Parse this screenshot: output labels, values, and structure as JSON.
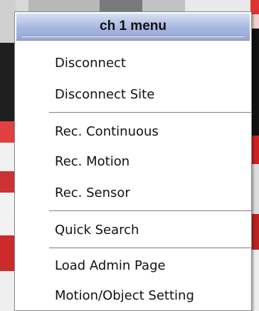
{
  "menu": {
    "title": "ch 1 menu",
    "items": [
      {
        "label": "Disconnect"
      },
      {
        "label": "Disconnect Site"
      },
      {
        "label": "Rec. Continuous"
      },
      {
        "label": "Rec. Motion"
      },
      {
        "label": "Rec. Sensor"
      },
      {
        "label": "Quick Search"
      },
      {
        "label": "Load Admin Page"
      },
      {
        "label": "Motion/Object Setting"
      }
    ]
  },
  "colors": {
    "title_gradient_top": "#d7dff1",
    "title_gradient_bottom": "#97a8d6",
    "menu_background": "#ffffff",
    "separator": "#7f7f7f"
  }
}
